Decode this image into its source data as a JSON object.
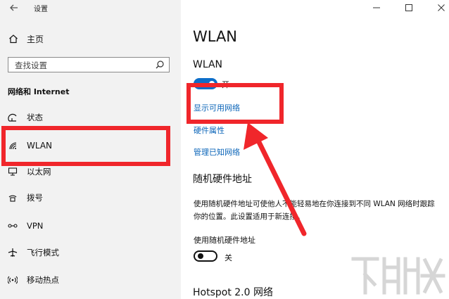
{
  "window": {
    "title": "设置"
  },
  "sidebar": {
    "home_label": "主页",
    "search_placeholder": "查找设置",
    "section_title": "网络和 Internet",
    "items": [
      {
        "label": "状态",
        "icon": "status-icon"
      },
      {
        "label": "WLAN",
        "icon": "wifi-icon"
      },
      {
        "label": "以太网",
        "icon": "ethernet-icon"
      },
      {
        "label": "拨号",
        "icon": "dialup-icon"
      },
      {
        "label": "VPN",
        "icon": "vpn-icon"
      },
      {
        "label": "飞行模式",
        "icon": "airplane-icon"
      },
      {
        "label": "移动热点",
        "icon": "hotspot-icon"
      }
    ],
    "active_item": "WLAN"
  },
  "main": {
    "page_title": "WLAN",
    "wlan_label": "WLAN",
    "wlan_toggle_state": "开",
    "links": {
      "show_networks": "显示可用网络",
      "hardware_props": "硬件属性",
      "manage_networks": "管理已知网络"
    },
    "random_hw": {
      "heading": "随机硬件地址",
      "description": "使用随机硬件地址可使他人不能轻易地在你连接到不同 WLAN 网络时跟踪你的位置。此设置适用于新连接。",
      "toggle_label": "使用随机硬件地址",
      "toggle_state": "关"
    },
    "hotspot_heading": "Hotspot 2.0 网络"
  },
  "colors": {
    "accent": "#0d6ec9",
    "link": "#0a64b8",
    "highlight": "#f0262b"
  }
}
